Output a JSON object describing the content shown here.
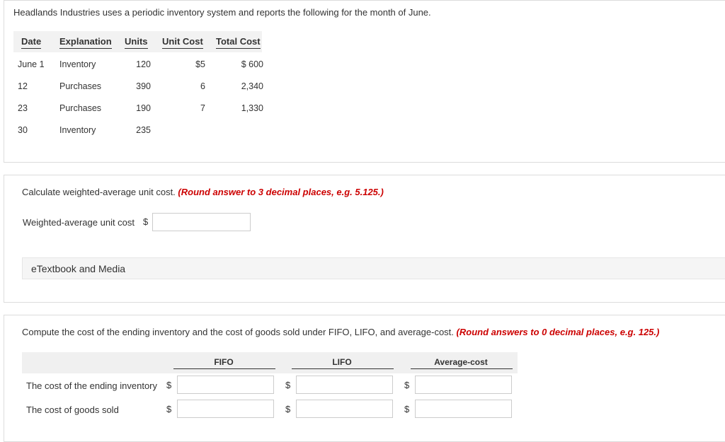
{
  "problem": {
    "intro": "Headlands Industries uses a periodic inventory system and reports the following for the month of June.",
    "table": {
      "headers": [
        "Date",
        "Explanation",
        "Units",
        "Unit Cost",
        "Total Cost"
      ],
      "rows": [
        {
          "date": "June 1",
          "explanation": "Inventory",
          "units": "120",
          "unit_cost": "$5",
          "total_cost": "$ 600"
        },
        {
          "date": "12",
          "explanation": "Purchases",
          "units": "390",
          "unit_cost": "6",
          "total_cost": "2,340"
        },
        {
          "date": "23",
          "explanation": "Purchases",
          "units": "190",
          "unit_cost": "7",
          "total_cost": "1,330"
        },
        {
          "date": "30",
          "explanation": "Inventory",
          "units": "235",
          "unit_cost": "",
          "total_cost": ""
        }
      ]
    }
  },
  "part1": {
    "question": "Calculate weighted-average unit cost.",
    "hint": "(Round answer to 3 decimal places, e.g. 5.125.)",
    "field_label": "Weighted-average unit cost",
    "currency": "$",
    "value": "",
    "etextbook_label": "eTextbook and Media"
  },
  "part2": {
    "question": "Compute the cost of the ending inventory and the cost of goods sold under FIFO, LIFO, and average-cost.",
    "hint": "(Round answers to 0 decimal places, e.g. 125.)",
    "columns": [
      "FIFO",
      "LIFO",
      "Average-cost"
    ],
    "rows": [
      {
        "label": "The cost of the ending inventory",
        "currency": "$",
        "values": [
          "",
          "",
          ""
        ]
      },
      {
        "label": "The cost of goods sold",
        "currency": "$",
        "values": [
          "",
          "",
          ""
        ]
      }
    ]
  },
  "colors": {
    "hint_red": "#cc0000",
    "panel_border": "#dcdcdc",
    "header_bg": "#f0f0f0"
  }
}
